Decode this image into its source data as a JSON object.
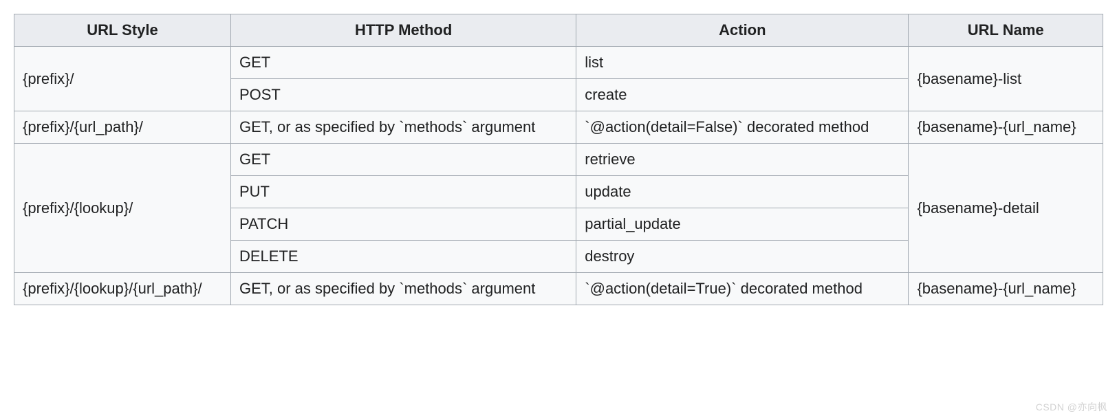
{
  "headers": {
    "url_style": "URL Style",
    "http_method": "HTTP Method",
    "action": "Action",
    "url_name": "URL Name"
  },
  "rows": {
    "r1": {
      "url_style": "{prefix}/",
      "method_a": "GET",
      "action_a": "list",
      "method_b": "POST",
      "action_b": "create",
      "url_name": "{basename}-list"
    },
    "r2": {
      "url_style": "{prefix}/{url_path}/",
      "method": "GET, or as specified by `methods` argument",
      "action": "`@action(detail=False)` decorated method",
      "url_name": "{basename}-{url_name}"
    },
    "r3": {
      "url_style": "{prefix}/{lookup}/",
      "method_a": "GET",
      "action_a": "retrieve",
      "method_b": "PUT",
      "action_b": "update",
      "method_c": "PATCH",
      "action_c": "partial_update",
      "method_d": "DELETE",
      "action_d": "destroy",
      "url_name": "{basename}-detail"
    },
    "r4": {
      "url_style": "{prefix}/{lookup}/{url_path}/",
      "method": "GET, or as specified by `methods` argument",
      "action": "`@action(detail=True)` decorated method",
      "url_name": "{basename}-{url_name}"
    }
  },
  "watermark": "CSDN @亦向枫"
}
